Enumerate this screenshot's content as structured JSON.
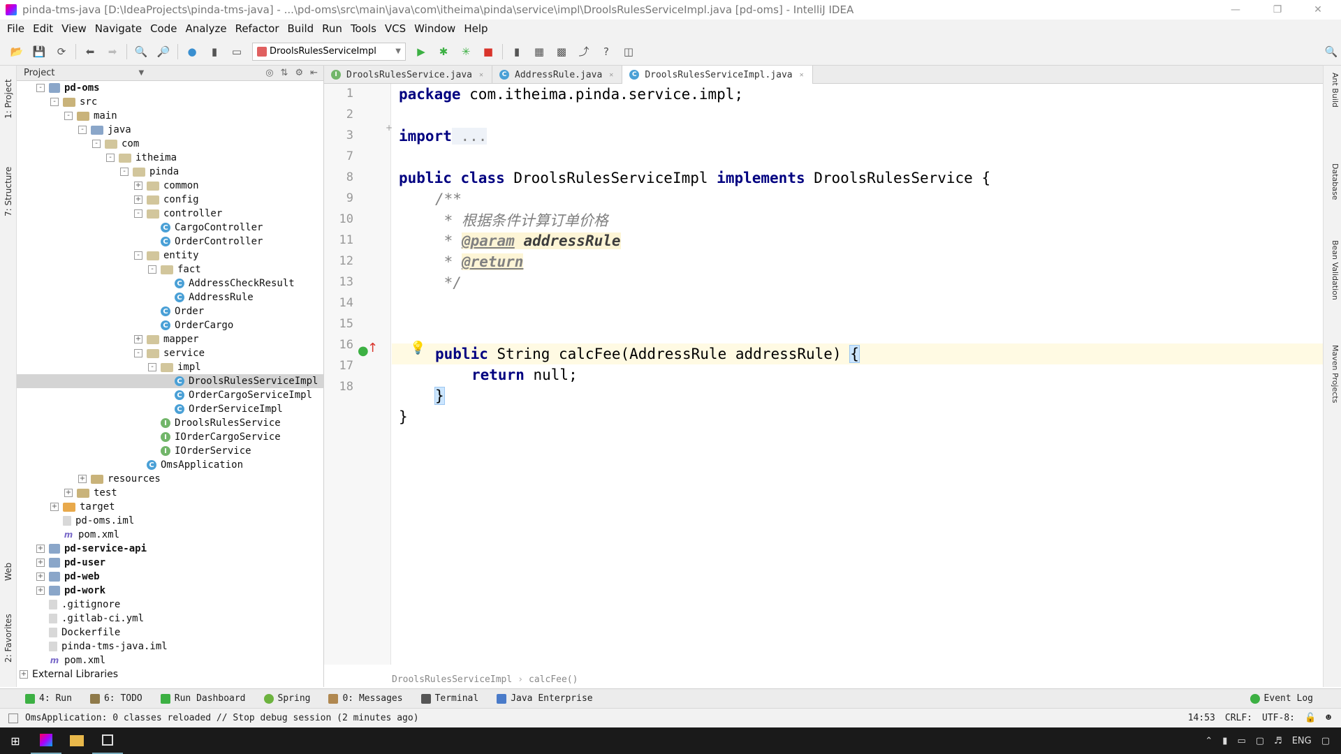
{
  "window": {
    "title": "pinda-tms-java [D:\\IdeaProjects\\pinda-tms-java] - ...\\pd-oms\\src\\main\\java\\com\\itheima\\pinda\\service\\impl\\DroolsRulesServiceImpl.java [pd-oms] - IntelliJ IDEA"
  },
  "menu": [
    "File",
    "Edit",
    "View",
    "Navigate",
    "Code",
    "Analyze",
    "Refactor",
    "Build",
    "Run",
    "Tools",
    "VCS",
    "Window",
    "Help"
  ],
  "toolbar": {
    "run_config": "DroolsRulesServiceImpl"
  },
  "left_tool_tabs": [
    "1: Project",
    "7: Structure",
    "Web",
    "2: Favorites"
  ],
  "right_tool_tabs": [
    "Ant Build",
    "Database",
    "Bean Validation",
    "Maven Projects"
  ],
  "project_panel": {
    "title": "Project",
    "tree": [
      {
        "label": "pd-oms",
        "depth": 0,
        "icon": "module",
        "expander": "-",
        "bold": true
      },
      {
        "label": "src",
        "depth": 1,
        "icon": "folder",
        "expander": "-"
      },
      {
        "label": "main",
        "depth": 2,
        "icon": "folder",
        "expander": "-"
      },
      {
        "label": "java",
        "depth": 3,
        "icon": "folder-src",
        "expander": "-"
      },
      {
        "label": "com",
        "depth": 4,
        "icon": "package",
        "expander": "-"
      },
      {
        "label": "itheima",
        "depth": 5,
        "icon": "package",
        "expander": "-"
      },
      {
        "label": "pinda",
        "depth": 6,
        "icon": "package",
        "expander": "-"
      },
      {
        "label": "common",
        "depth": 7,
        "icon": "package",
        "expander": "+"
      },
      {
        "label": "config",
        "depth": 7,
        "icon": "package",
        "expander": "+"
      },
      {
        "label": "controller",
        "depth": 7,
        "icon": "package",
        "expander": "-"
      },
      {
        "label": "CargoController",
        "depth": 8,
        "icon": "class",
        "expander": ""
      },
      {
        "label": "OrderController",
        "depth": 8,
        "icon": "class",
        "expander": ""
      },
      {
        "label": "entity",
        "depth": 7,
        "icon": "package",
        "expander": "-"
      },
      {
        "label": "fact",
        "depth": 8,
        "icon": "package",
        "expander": "-"
      },
      {
        "label": "AddressCheckResult",
        "depth": 9,
        "icon": "class",
        "expander": ""
      },
      {
        "label": "AddressRule",
        "depth": 9,
        "icon": "class",
        "expander": ""
      },
      {
        "label": "Order",
        "depth": 8,
        "icon": "class",
        "expander": ""
      },
      {
        "label": "OrderCargo",
        "depth": 8,
        "icon": "class",
        "expander": ""
      },
      {
        "label": "mapper",
        "depth": 7,
        "icon": "package",
        "expander": "+"
      },
      {
        "label": "service",
        "depth": 7,
        "icon": "package",
        "expander": "-"
      },
      {
        "label": "impl",
        "depth": 8,
        "icon": "package",
        "expander": "-"
      },
      {
        "label": "DroolsRulesServiceImpl",
        "depth": 9,
        "icon": "class",
        "expander": "",
        "selected": true
      },
      {
        "label": "OrderCargoServiceImpl",
        "depth": 9,
        "icon": "class",
        "expander": ""
      },
      {
        "label": "OrderServiceImpl",
        "depth": 9,
        "icon": "class",
        "expander": ""
      },
      {
        "label": "DroolsRulesService",
        "depth": 8,
        "icon": "interface",
        "expander": ""
      },
      {
        "label": "IOrderCargoService",
        "depth": 8,
        "icon": "interface",
        "expander": ""
      },
      {
        "label": "IOrderService",
        "depth": 8,
        "icon": "interface",
        "expander": ""
      },
      {
        "label": "OmsApplication",
        "depth": 7,
        "icon": "app",
        "expander": ""
      },
      {
        "label": "resources",
        "depth": 3,
        "icon": "folder",
        "expander": "+"
      },
      {
        "label": "test",
        "depth": 2,
        "icon": "folder",
        "expander": "+"
      },
      {
        "label": "target",
        "depth": 1,
        "icon": "folder-orange",
        "expander": "+"
      },
      {
        "label": "pd-oms.iml",
        "depth": 1,
        "icon": "file",
        "expander": ""
      },
      {
        "label": "pom.xml",
        "depth": 1,
        "icon": "maven",
        "expander": ""
      },
      {
        "label": "pd-service-api",
        "depth": 0,
        "icon": "module",
        "expander": "+",
        "bold": true
      },
      {
        "label": "pd-user",
        "depth": 0,
        "icon": "module",
        "expander": "+",
        "bold": true
      },
      {
        "label": "pd-web",
        "depth": 0,
        "icon": "module",
        "expander": "+",
        "bold": true
      },
      {
        "label": "pd-work",
        "depth": 0,
        "icon": "module",
        "expander": "+",
        "bold": true
      },
      {
        "label": ".gitignore",
        "depth": 0,
        "icon": "file",
        "expander": ""
      },
      {
        "label": ".gitlab-ci.yml",
        "depth": 0,
        "icon": "file",
        "expander": ""
      },
      {
        "label": "Dockerfile",
        "depth": 0,
        "icon": "file",
        "expander": ""
      },
      {
        "label": "pinda-tms-java.iml",
        "depth": 0,
        "icon": "file",
        "expander": ""
      },
      {
        "label": "pom.xml",
        "depth": 0,
        "icon": "maven",
        "expander": ""
      },
      {
        "label": "External Libraries",
        "depth": -1,
        "icon": "none",
        "expander": "+"
      }
    ]
  },
  "editor": {
    "tabs": [
      {
        "label": "DroolsRulesService.java",
        "icon": "I",
        "active": false
      },
      {
        "label": "AddressRule.java",
        "icon": "C",
        "active": false
      },
      {
        "label": "DroolsRulesServiceImpl.java",
        "icon": "C",
        "active": true
      }
    ],
    "line_numbers": [
      "1",
      "2",
      "3",
      "7",
      "8",
      "9",
      "10",
      "11",
      "12",
      "13",
      "14",
      "15",
      "16",
      "17",
      "18"
    ],
    "code": {
      "l1_kw": "package",
      "l1_rest": " com.itheima.pinda.service.impl;",
      "l3_kw": "import",
      "l3_fold": " ...",
      "l8_kw1": "public",
      "l8_kw2": "class",
      "l8_name": " DroolsRulesServiceImpl ",
      "l8_kw3": "implements",
      "l8_rest": " DroolsRulesService {",
      "l9": "/**",
      "l10": " * 根据条件计算订单价格",
      "l11_prefix": " * ",
      "l11_tag": "@param",
      "l11_param": " addressRule",
      "l12_prefix": " * ",
      "l12_tag": "@return",
      "l13": " */",
      "l14_kw": "public",
      "l14_rest": " String calcFee(AddressRule addressRule) ",
      "l14_brace": "{",
      "l15_kw": "return",
      "l15_rest": " null;",
      "l16": "}",
      "l17": "}"
    },
    "breadcrumb": [
      "DroolsRulesServiceImpl",
      "calcFee()"
    ]
  },
  "bottom_tools": [
    "4: Run",
    "6: TODO",
    "Run Dashboard",
    "Spring",
    "0: Messages",
    "Terminal",
    "Java Enterprise"
  ],
  "event_log": "Event Log",
  "status": {
    "message": "OmsApplication: 0 classes reloaded // Stop debug session (2 minutes ago)",
    "position": "14:53",
    "line_sep": "CRLF:",
    "encoding": "UTF-8:"
  },
  "taskbar": {
    "lang": "ENG"
  }
}
